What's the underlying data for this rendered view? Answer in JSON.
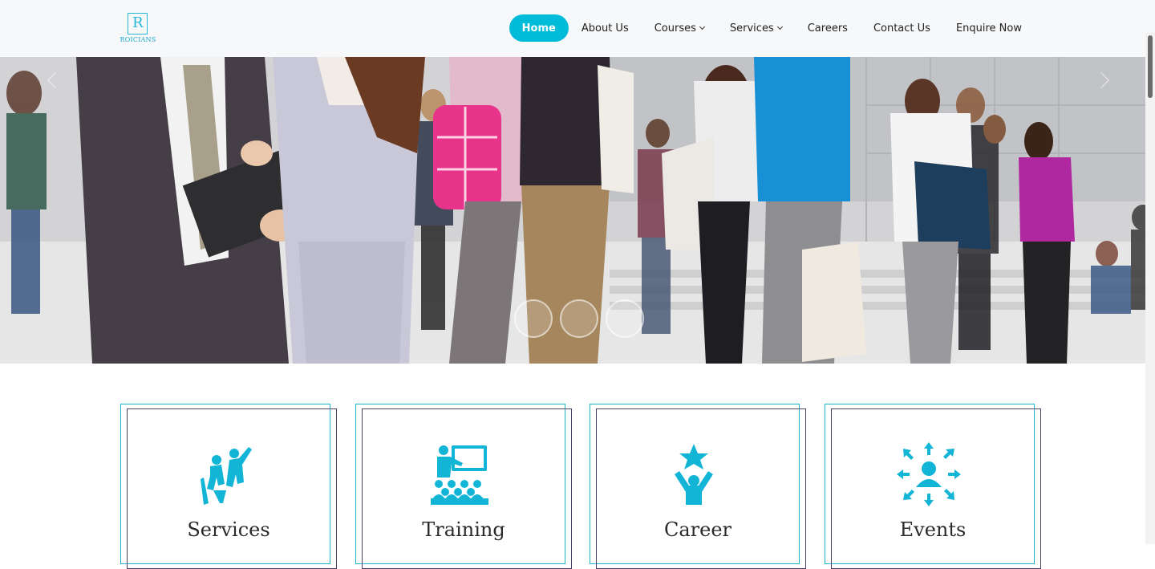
{
  "brand": {
    "logo_letter": "R",
    "logo_text": "ROICIANS",
    "accent": "#00bcd9"
  },
  "nav": {
    "items": [
      {
        "label": "Home",
        "active": true,
        "dropdown": false
      },
      {
        "label": "About Us",
        "active": false,
        "dropdown": false
      },
      {
        "label": "Courses",
        "active": false,
        "dropdown": true
      },
      {
        "label": "Services",
        "active": false,
        "dropdown": true
      },
      {
        "label": "Careers",
        "active": false,
        "dropdown": false
      },
      {
        "label": "Contact Us",
        "active": false,
        "dropdown": false
      },
      {
        "label": "Enquire Now",
        "active": false,
        "dropdown": false
      }
    ]
  },
  "hero": {
    "slide_count": 3,
    "icons": [
      "chevron-left-icon",
      "chevron-right-icon"
    ]
  },
  "cards": [
    {
      "title": "Services",
      "icon": "team-presentation-icon"
    },
    {
      "title": "Training",
      "icon": "classroom-training-icon"
    },
    {
      "title": "Career",
      "icon": "career-star-icon"
    },
    {
      "title": "Events",
      "icon": "network-events-icon"
    }
  ]
}
